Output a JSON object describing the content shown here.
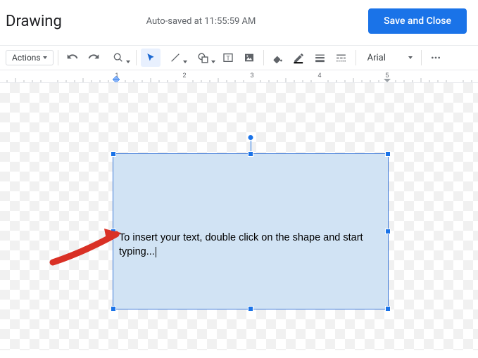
{
  "header": {
    "title": "Drawing",
    "autosave": "Auto-saved at 11:55:59 AM",
    "save_close": "Save and Close"
  },
  "toolbar": {
    "actions": "Actions",
    "font": "Arial"
  },
  "shape": {
    "text": "To insert your text, double click on the shape and start typing..."
  },
  "ruler": {
    "marks": [
      "1",
      "2",
      "3",
      "4",
      "5"
    ]
  }
}
